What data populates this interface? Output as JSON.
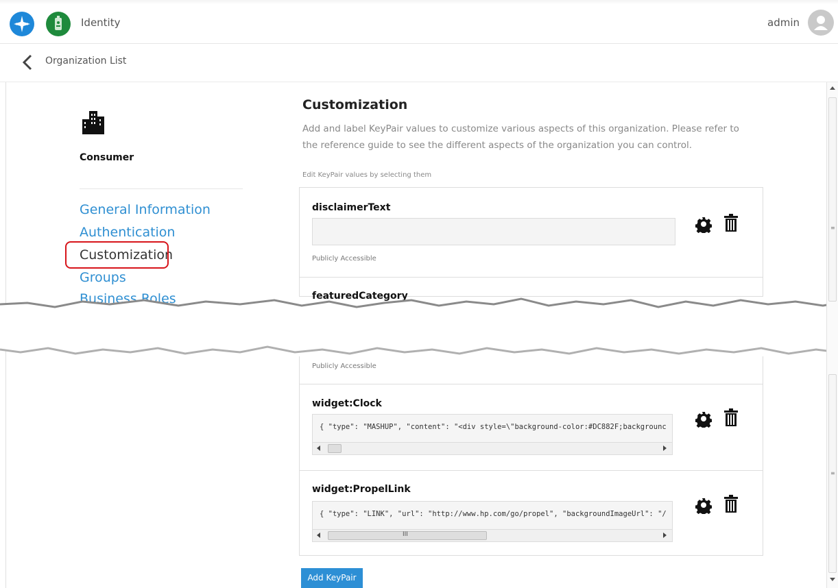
{
  "header": {
    "app_title": "Identity",
    "user_name": "admin",
    "icons": [
      "airplane-logo",
      "badge-logo",
      "user-avatar"
    ]
  },
  "breadcrumb": {
    "label": "Organization List",
    "icon": "chevron-left-icon"
  },
  "sidebar": {
    "org_name": "Consumer",
    "org_icon": "buildings-icon",
    "items": [
      {
        "label": "General Information"
      },
      {
        "label": "Authentication"
      },
      {
        "label": "Customization",
        "active": true
      },
      {
        "label": "Groups"
      },
      {
        "label": "Business Roles"
      }
    ]
  },
  "main": {
    "title": "Customization",
    "description": "Add and label KeyPair values to customize various aspects of this organization. Please refer to the reference guide to see the different aspects of the organization you can control.",
    "hint": "Edit KeyPair values by selecting them",
    "keypairs": [
      {
        "name": "disclaimerText",
        "value": "",
        "access": "Publicly Accessible"
      },
      {
        "name": "featuredCategory",
        "access": "Publicly Accessible"
      },
      {
        "name": "widget:Clock",
        "value": "{ \"type\": \"MASHUP\", \"content\": \"<div style=\\\"background-color:#DC882F;backgrounc"
      },
      {
        "name": "widget:PropelLink",
        "value": "{ \"type\": \"LINK\", \"url\": \"http://www.hp.com/go/propel\", \"backgroundImageUrl\": \"/"
      }
    ],
    "scroll_grip": "III",
    "add_button": "Add KeyPair"
  },
  "colors": {
    "accent_blue": "#2d8fd5",
    "link_blue": "#2f8fd2",
    "highlight_red": "#d7141a",
    "logo_blue": "#1e88d9",
    "logo_green": "#1e8a3c"
  }
}
